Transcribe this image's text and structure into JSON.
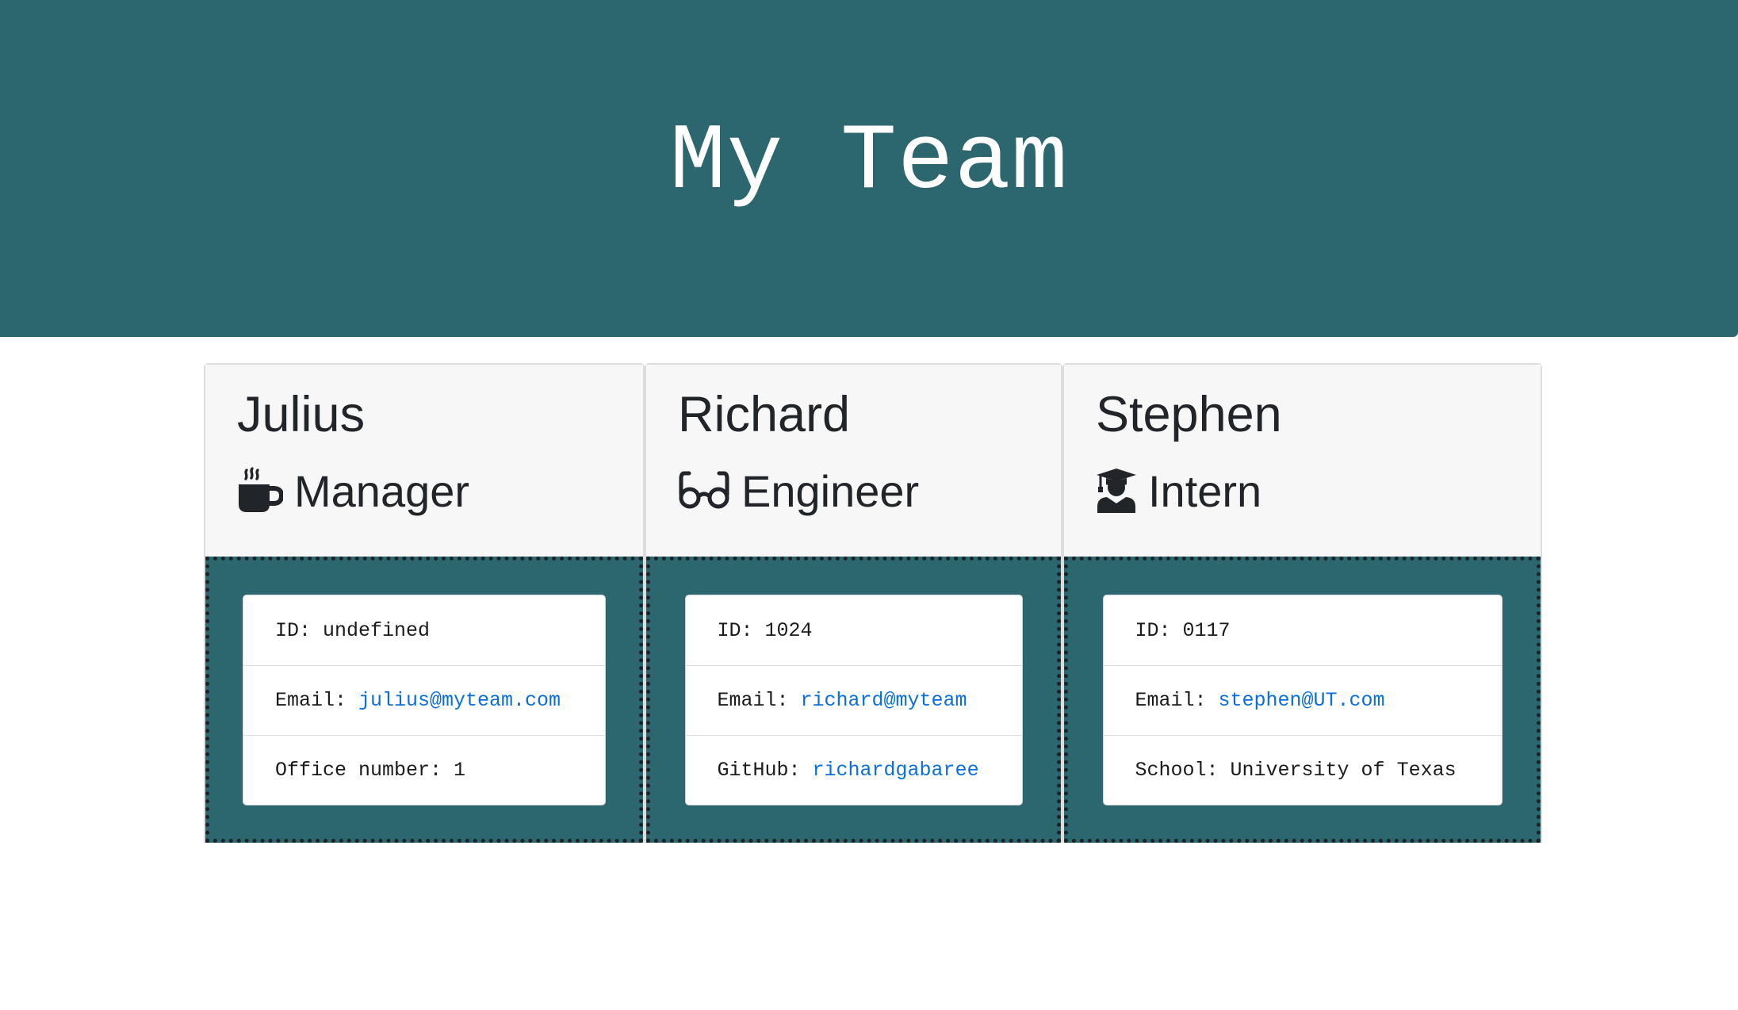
{
  "header": {
    "title": "My Team"
  },
  "employees": [
    {
      "name": "Julius",
      "role": "Manager",
      "role_icon": "coffee-mug-icon",
      "details": {
        "id_label": "ID:",
        "id_value": "undefined",
        "email_label": "Email:",
        "email_value": "julius@myteam.com",
        "extra_label": "Office number:",
        "extra_value": "1"
      }
    },
    {
      "name": "Richard",
      "role": "Engineer",
      "role_icon": "glasses-icon",
      "details": {
        "id_label": "ID:",
        "id_value": "1024",
        "email_label": "Email:",
        "email_value": "richard@myteam",
        "extra_label": "GitHub:",
        "extra_value": "richardgabaree"
      }
    },
    {
      "name": "Stephen",
      "role": "Intern",
      "role_icon": "graduate-icon",
      "details": {
        "id_label": "ID:",
        "id_value": "0117",
        "email_label": "Email:",
        "email_value": "stephen@UT.com",
        "extra_label": "School:",
        "extra_value": "University of Texas"
      }
    }
  ],
  "colors": {
    "header_bg": "#2c666e",
    "card_body_bg": "#2c666e",
    "link": "#0a6fdc",
    "text": "#212529"
  }
}
